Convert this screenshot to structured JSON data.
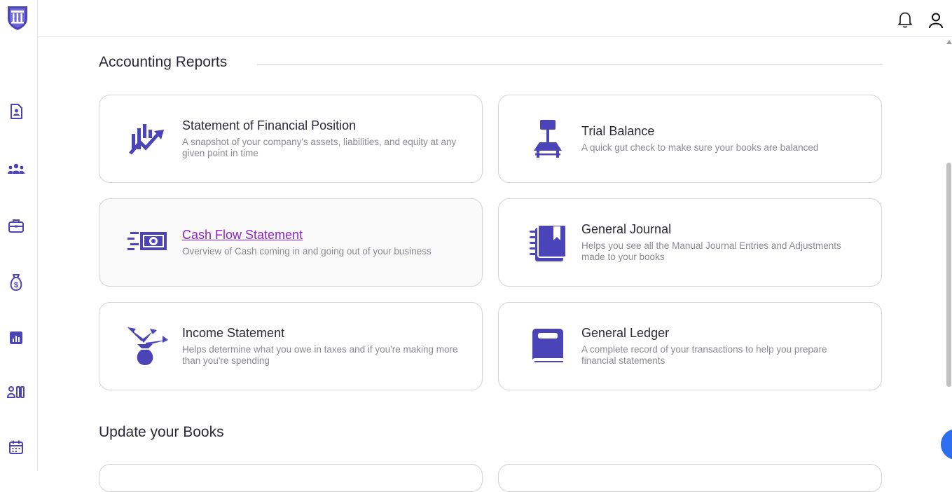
{
  "colors": {
    "accent": "#4b44b8",
    "link_visited": "#9124c6",
    "chat": "#2d6ff0"
  },
  "sidebar": {
    "logo": "bank-logo-icon",
    "items": [
      {
        "icon": "contact-document-icon"
      },
      {
        "icon": "team-icon"
      },
      {
        "icon": "briefcase-icon"
      },
      {
        "icon": "money-bag-icon"
      },
      {
        "icon": "bar-chart-icon"
      },
      {
        "icon": "user-list-icon"
      },
      {
        "icon": "calendar-icon"
      }
    ]
  },
  "topbar": {
    "notifications_icon": "bell-icon",
    "profile_icon": "user-icon"
  },
  "accounting_reports": {
    "title": "Accounting Reports",
    "cards": [
      {
        "title": "Statement of Financial Position",
        "description": "A snapshot of your company's assets, liabilities, and equity at any given point in time",
        "icon": "chart-growth-icon"
      },
      {
        "title": "Trial Balance",
        "description": "A quick gut check to make sure your books are balanced",
        "icon": "scale-icon"
      },
      {
        "title": "Cash Flow Statement",
        "description": "Overview of Cash coming in and going out of your business",
        "icon": "cash-flow-icon"
      },
      {
        "title": "General Journal",
        "description": "Helps you see all the Manual Journal Entries and Adjustments made to your books",
        "icon": "journal-icon"
      },
      {
        "title": "Income Statement",
        "description": "Helps determine what you owe in taxes and if you're making more than you're spending",
        "icon": "income-bag-icon"
      },
      {
        "title": "General Ledger",
        "description": "A complete record of your transactions to help you prepare financial statements",
        "icon": "ledger-book-icon"
      }
    ]
  },
  "update_books": {
    "title": "Update your Books"
  }
}
